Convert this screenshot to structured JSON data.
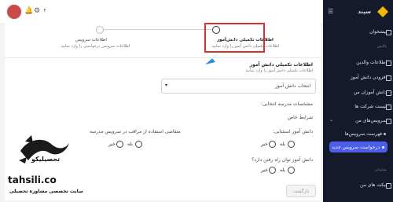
{
  "brand": {
    "name": "سپند"
  },
  "topbar": {
    "badge": "۴"
  },
  "steps": [
    {
      "title": "اطلاعات تکمیلی دانش‌آموز",
      "subtitle": "اطلاعات تکمیلی دانش آموز را وارد نمایید."
    },
    {
      "title": "اطلاعات سرویس",
      "subtitle": "اطلاعات سرویس درخواستی را وارد نمایید."
    }
  ],
  "form": {
    "heading": "اطلاعات تکمیلی دانش آموز",
    "subheading": "اطلاعات تکمیلی دانش آموز را وارد نمایید",
    "select_placeholder": "انتخاب دانش آموز",
    "section_title": "مشخصات مدرسه انتخابی:",
    "special_title": "شرایط خاص",
    "q_exceptional": "دانش آموز استثنایی:",
    "q_supervisor": "متقاضی استفاده از مراقب در سرویس مدرسه",
    "q_walk": "دانش آموز توان راه رفتن دارد؟",
    "yes": "بله",
    "no": "خیر",
    "next_button": "بازگشت"
  },
  "sidebar": {
    "dashboard": "پیشخوان",
    "section_label": "پالایش",
    "items": [
      "اطلاعات والدین",
      "افزودن دانش آموز",
      "دانش آموزان من",
      "لیست شرکت ها",
      "سرویس‌های من",
      "فهرست سرویس‌ها",
      "درخواست سرویس جدید"
    ],
    "support_label": "پشتیبانی",
    "tickets": "تیکت های من"
  },
  "watermark": {
    "brand": "تحصیلیکو",
    "url": "tahsili.co",
    "tagline": "سایت تخصصی مشاوره تحصیلی"
  },
  "colors": {
    "highlight": "#d9302c",
    "accent": "#4a5ee8",
    "sidebar": "#141a2b"
  }
}
